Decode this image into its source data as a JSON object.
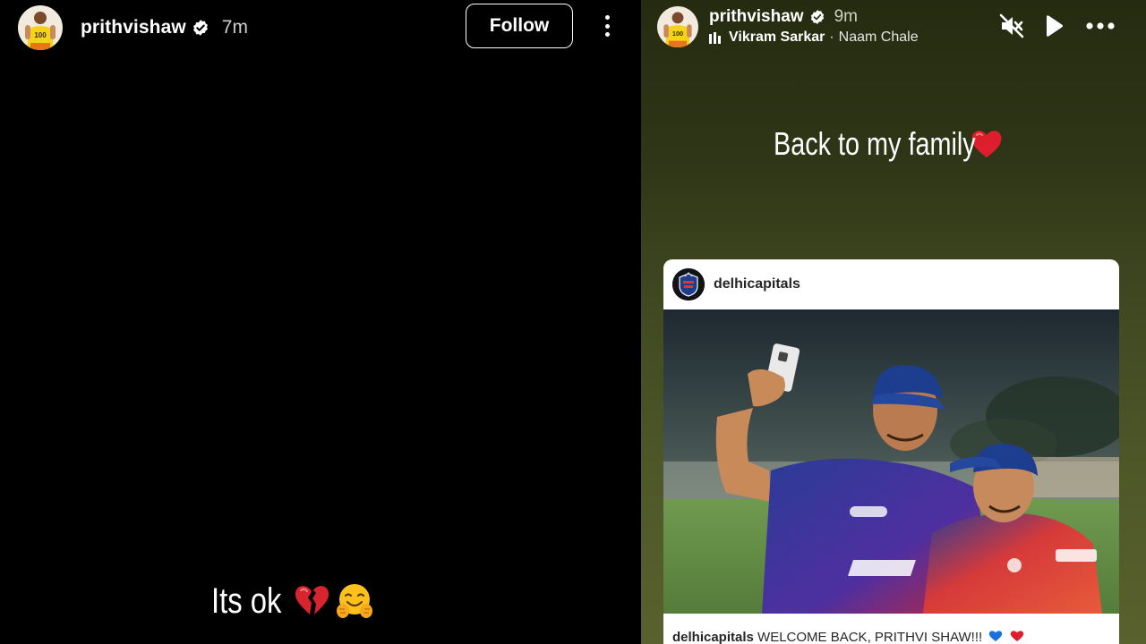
{
  "left_story": {
    "username": "prithvishaw",
    "time": "7m",
    "follow_label": "Follow",
    "caption": "Its ok",
    "caption_emojis": [
      "broken-heart-emoji",
      "hugging-face-emoji"
    ]
  },
  "right_story": {
    "username": "prithvishaw",
    "time": "9m",
    "music": {
      "artist": "Vikram Sarkar",
      "separator": "·",
      "song": "Naam Chale"
    },
    "controls": [
      "mute-icon",
      "play-icon",
      "more-icon"
    ],
    "caption": "Back to my family",
    "caption_emoji": "red-heart-emoji",
    "shared_post": {
      "account": "delhicapitals",
      "caption_user": "delhicapitals",
      "caption_text": "WELCOME BACK, PRITHVI SHAW!!!",
      "caption_emojis": [
        "blue-heart-emoji",
        "red-heart-emoji"
      ]
    }
  },
  "colors": {
    "story_left_bg": "#000000",
    "story_right_bg_top": "#252b10",
    "story_right_bg_bottom": "#59612d",
    "verified_blue": "#ffffff",
    "text_primary": "#ffffff",
    "card_bg": "#ffffff"
  }
}
